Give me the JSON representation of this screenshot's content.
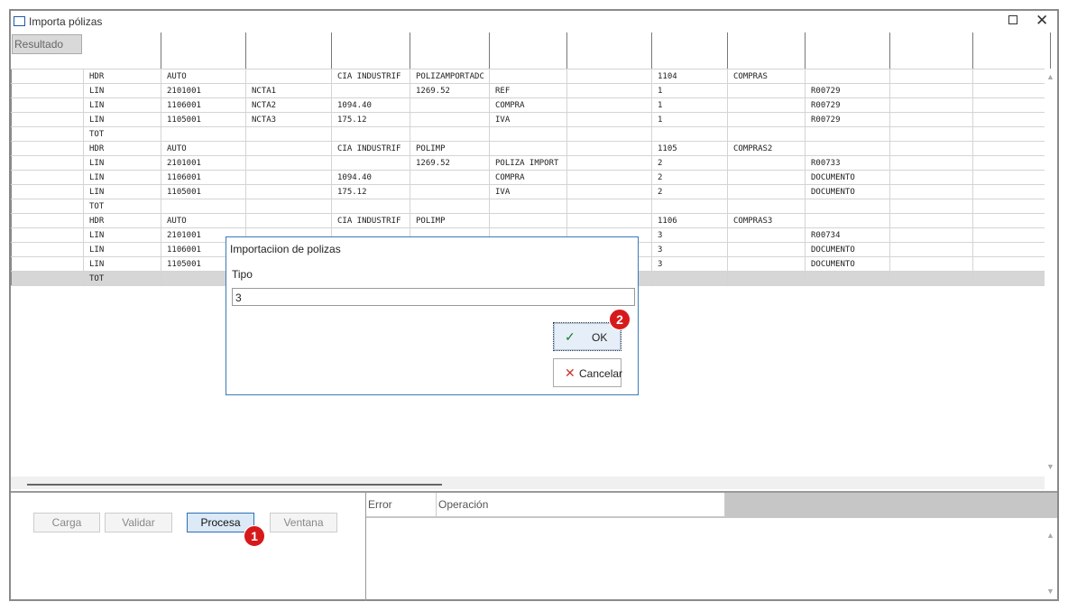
{
  "window": {
    "title": "Importa pólizas"
  },
  "grid": {
    "header_button": "Resultado",
    "rows": [
      [
        "",
        "HDR",
        "AUTO",
        "",
        "CIA INDUSTRIF",
        "POLIZAMPORTADC",
        "",
        "",
        "1104",
        "COMPRAS",
        "",
        "",
        ""
      ],
      [
        "",
        "LIN",
        "2101001",
        "NCTA1",
        "",
        "1269.52",
        "REF",
        "",
        "1",
        "",
        "R00729",
        "",
        ""
      ],
      [
        "",
        "LIN",
        "1106001",
        "NCTA2",
        "1094.40",
        "",
        "COMPRA",
        "",
        "1",
        "",
        "R00729",
        "",
        ""
      ],
      [
        "",
        "LIN",
        "1105001",
        "NCTA3",
        "175.12",
        "",
        "IVA",
        "",
        "1",
        "",
        "R00729",
        "",
        ""
      ],
      [
        "",
        "TOT",
        "",
        "",
        "",
        "",
        "",
        "",
        "",
        "",
        "",
        "",
        ""
      ],
      [
        "",
        "HDR",
        "AUTO",
        "",
        "CIA INDUSTRIF",
        "POLIMP",
        "",
        "",
        "1105",
        "COMPRAS2",
        "",
        "",
        ""
      ],
      [
        "",
        "LIN",
        "2101001",
        "",
        "",
        "1269.52",
        "POLIZA IMPORT",
        "",
        "2",
        "",
        "R00733",
        "",
        ""
      ],
      [
        "",
        "LIN",
        "1106001",
        "",
        "1094.40",
        "",
        "COMPRA",
        "",
        "2",
        "",
        "DOCUMENTO",
        "",
        ""
      ],
      [
        "",
        "LIN",
        "1105001",
        "",
        "175.12",
        "",
        "IVA",
        "",
        "2",
        "",
        "DOCUMENTO",
        "",
        ""
      ],
      [
        "",
        "TOT",
        "",
        "",
        "",
        "",
        "",
        "",
        "",
        "",
        "",
        "",
        ""
      ],
      [
        "",
        "HDR",
        "AUTO",
        "",
        "CIA INDUSTRIF",
        "POLIMP",
        "",
        "",
        "1106",
        "COMPRAS3",
        "",
        "",
        ""
      ],
      [
        "",
        "LIN",
        "2101001",
        "",
        "",
        "",
        "",
        "",
        "3",
        "",
        "R00734",
        "",
        ""
      ],
      [
        "",
        "LIN",
        "1106001",
        "",
        "",
        "",
        "",
        "",
        "3",
        "",
        "DOCUMENTO",
        "",
        ""
      ],
      [
        "",
        "LIN",
        "1105001",
        "",
        "",
        "",
        "",
        "",
        "3",
        "",
        "DOCUMENTO",
        "",
        ""
      ],
      [
        "",
        "TOT",
        "",
        "",
        "",
        "",
        "",
        "",
        "",
        "",
        "",
        "",
        ""
      ]
    ]
  },
  "actions": {
    "carga": "Carga",
    "validar": "Validar",
    "procesa": "Procesa",
    "ventana": "Ventana"
  },
  "errors": {
    "col_error": "Error",
    "col_operacion": "Operación"
  },
  "dialog": {
    "title": "Importaciion de polizas",
    "label": "Tipo",
    "value": "3",
    "ok": "OK",
    "cancel": "Cancelar"
  },
  "badges": {
    "one": "1",
    "two": "2"
  },
  "colors": {
    "accent": "#2d6fb5",
    "badge": "#d7191c",
    "selected_row": "#d6d6d6"
  }
}
